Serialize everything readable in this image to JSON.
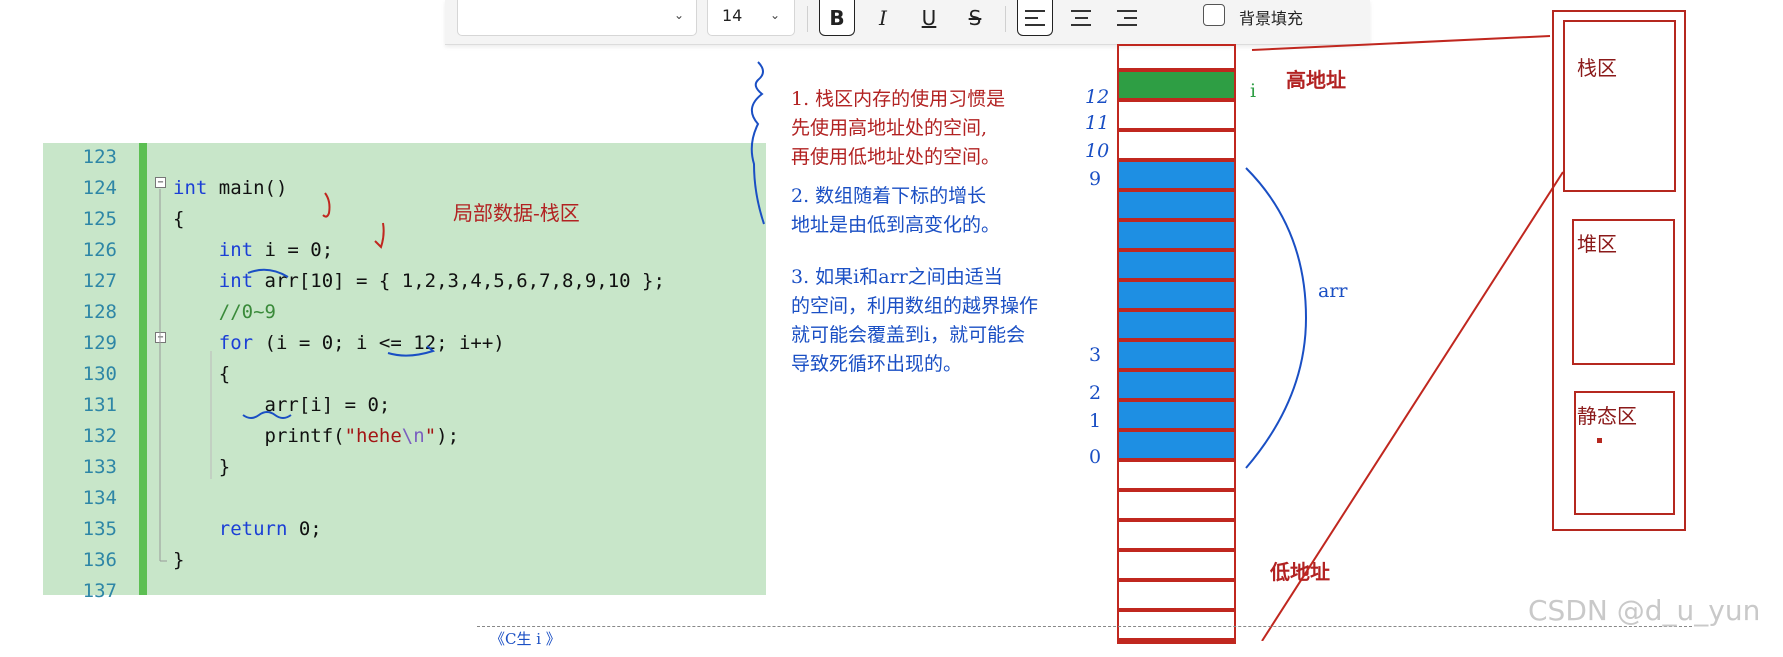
{
  "toolbar": {
    "font_size": "14",
    "bold_label": "B",
    "italic_label": "I",
    "underline_label": "U",
    "strike_label": "S",
    "fill_label": "背景填充"
  },
  "editor": {
    "lines": [
      {
        "num": "123",
        "code": ""
      },
      {
        "num": "124",
        "code": "int main()"
      },
      {
        "num": "125",
        "code": "{"
      },
      {
        "num": "126",
        "code": "    int i = 0;"
      },
      {
        "num": "127",
        "code": "    int arr[10] = { 1,2,3,4,5,6,7,8,9,10 };"
      },
      {
        "num": "128",
        "code": "    //0~9"
      },
      {
        "num": "129",
        "code": "    for (i = 0; i <= 12; i++)"
      },
      {
        "num": "130",
        "code": "    {"
      },
      {
        "num": "131",
        "code": "        arr[i] = 0;"
      },
      {
        "num": "132",
        "code": "        printf(\"hehe\\n\");"
      },
      {
        "num": "133",
        "code": "    }"
      },
      {
        "num": "134",
        "code": ""
      },
      {
        "num": "135",
        "code": "    return 0;"
      },
      {
        "num": "136",
        "code": "}"
      },
      {
        "num": "137",
        "code": ""
      }
    ],
    "annotation": "局部数据-栈区"
  },
  "notes": {
    "n1": [
      "1. 栈区内存的使用习惯是",
      "先使用高地址处的空间,",
      "再使用低地址处的空间。"
    ],
    "n2": [
      "2. 数组随着下标的增长",
      "地址是由低到高变化的。"
    ],
    "n3": [
      "3. 如果i和arr之间由适当",
      "的空间，利用数组的越界操作",
      "就可能会覆盖到i，就可能会",
      "导致死循环出现的。"
    ]
  },
  "stack": {
    "high_label": "高地址",
    "low_label": "低地址",
    "i_label": "i",
    "arr_label": "arr",
    "hand_indices": [
      "12",
      "11",
      "10",
      "9",
      "3",
      "2",
      "1",
      "0"
    ],
    "colors": {
      "i_cell": "#2e9e44",
      "arr_cell": "#1e8fe3",
      "border": "#c0271f"
    }
  },
  "memory_map": {
    "regions": [
      "栈区",
      "堆区",
      "静态区"
    ]
  },
  "watermark": "CSDN @d_u_yun",
  "bottom_text": "《C生 i 》"
}
